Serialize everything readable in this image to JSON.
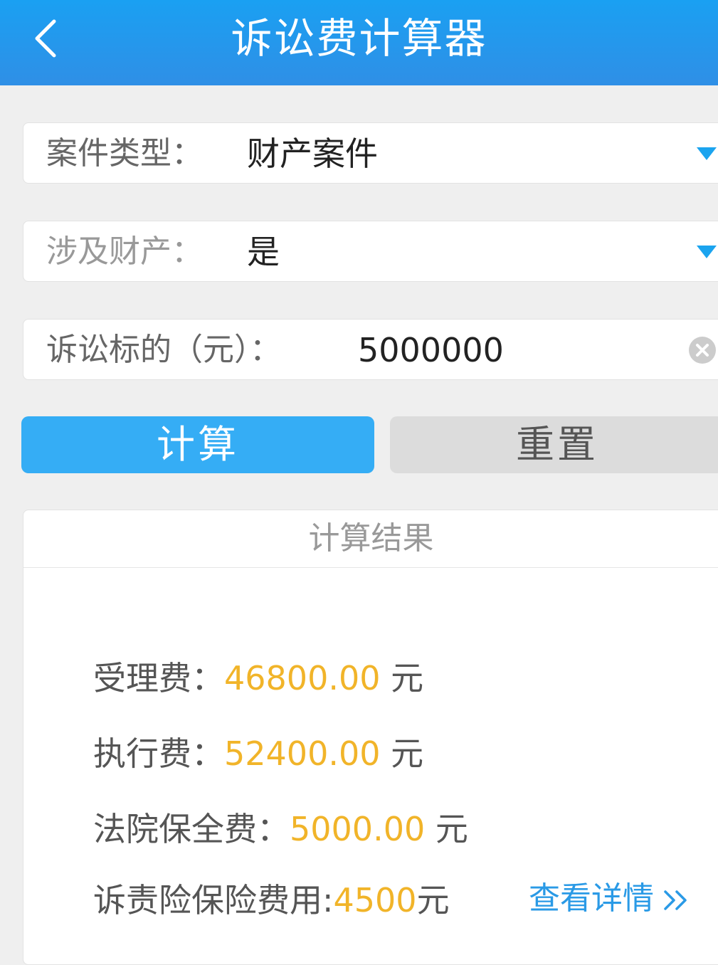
{
  "header": {
    "title": "诉讼费计算器"
  },
  "form": {
    "case_type": {
      "label": "案件类型：",
      "value": "财产案件"
    },
    "involves_property": {
      "label": "涉及财产：",
      "value": "是"
    },
    "claim_amount": {
      "label": "诉讼标的（元）：",
      "value": "5000000"
    }
  },
  "buttons": {
    "calculate": "计算",
    "reset": "重置"
  },
  "result": {
    "title": "计算结果",
    "acceptance_fee": {
      "label": "受理费：",
      "amount": "46800.00",
      "unit": " 元"
    },
    "execution_fee": {
      "label": "执行费：",
      "amount": "52400.00",
      "unit": " 元"
    },
    "preservation_fee": {
      "label": "法院保全费：",
      "amount": "5000.00",
      "unit": " 元"
    },
    "insurance_fee": {
      "label": "诉责险保险费用:",
      "amount": "4500",
      "unit": "元"
    },
    "detail_link": "查看详情"
  },
  "colors": {
    "header": "#2a96ea",
    "primary_button": "#35adf5",
    "amount": "#f1b429",
    "link": "#2a9ae6"
  },
  "icons": [
    "back-arrow-icon",
    "dropdown-arrow-icon",
    "clear-icon",
    "double-chevron-right-icon"
  ]
}
